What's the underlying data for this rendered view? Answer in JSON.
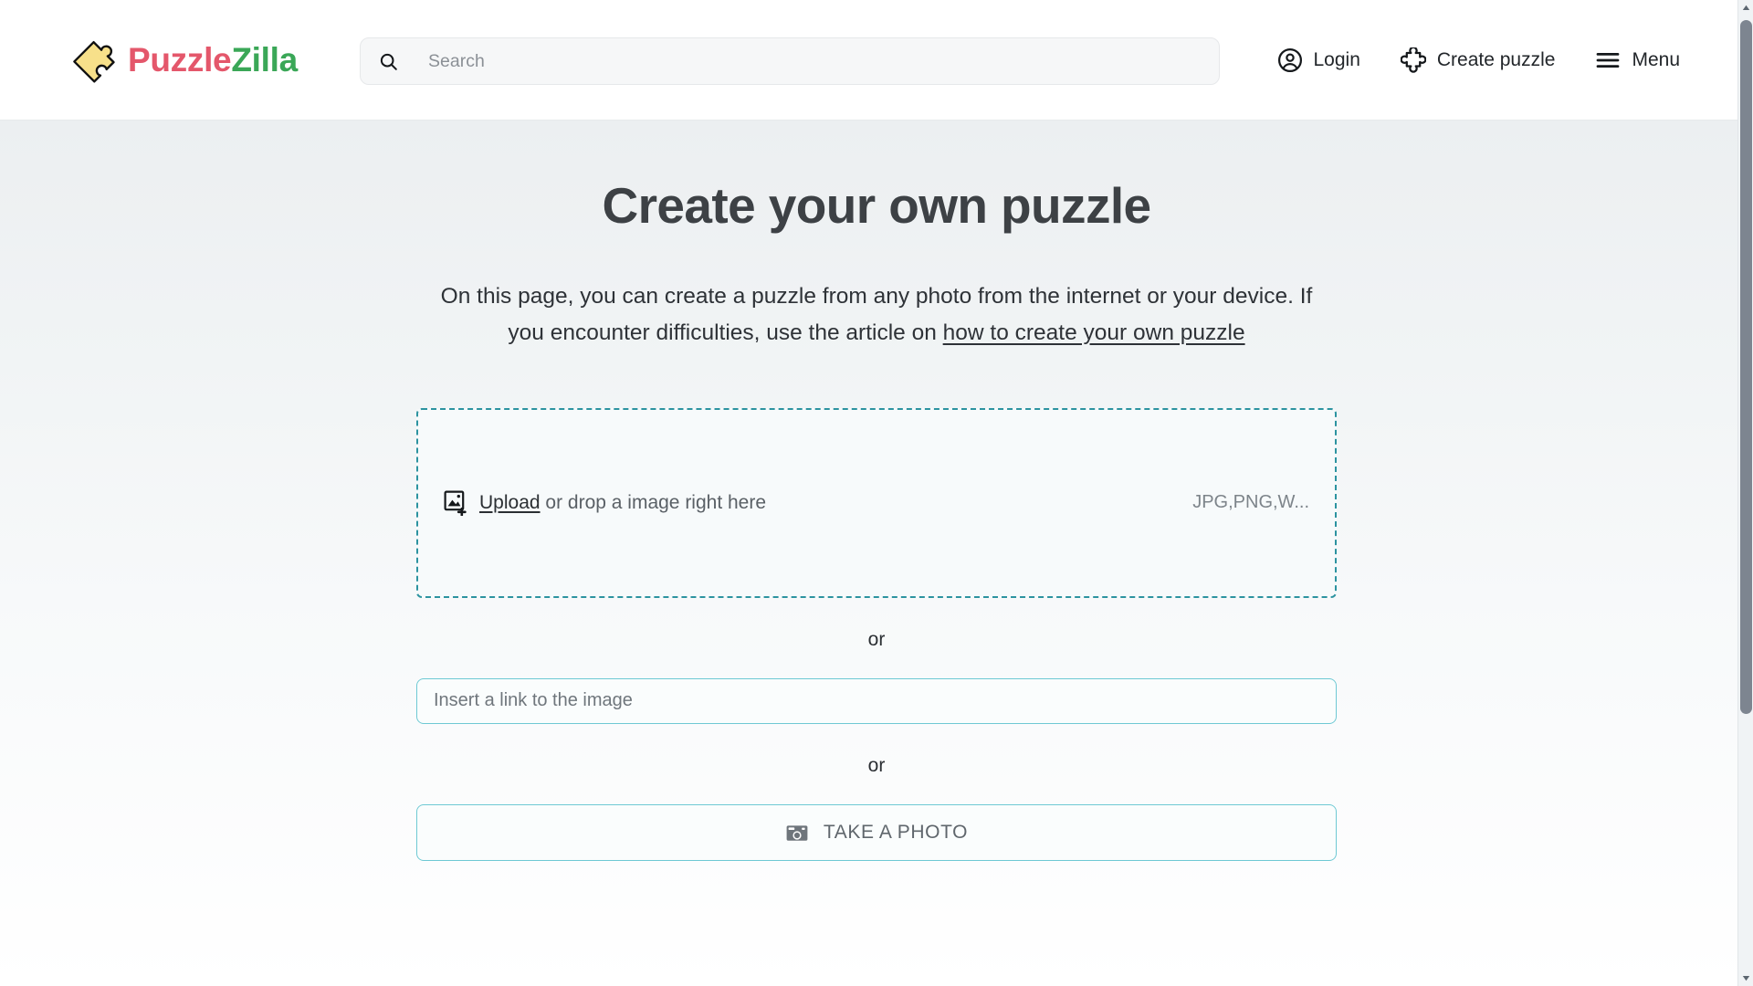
{
  "header": {
    "logo": {
      "icon": "puzzle-piece-logo-icon",
      "text_first": "Puzzle",
      "text_second": "Zilla"
    },
    "search": {
      "placeholder": "Search",
      "value": "",
      "icon": "search-icon"
    },
    "nav": [
      {
        "label": "Login",
        "icon": "user-circle-icon"
      },
      {
        "label": "Create puzzle",
        "icon": "puzzle-piece-icon"
      },
      {
        "label": "Menu",
        "icon": "hamburger-menu-icon"
      }
    ]
  },
  "main": {
    "title": "Create your own puzzle",
    "intro": {
      "before": "On this page, you can create a puzzle from any photo from the internet or your device. If you encounter difficulties, use the article on ",
      "link": "how to create your own puzzle"
    },
    "dropzone": {
      "icon": "add-image-icon",
      "upload_link": "Upload",
      "rest_text": " or drop a image right here",
      "formats": "JPG,PNG,W...",
      "border_color": "#2c93a0"
    },
    "or_label_1": "or",
    "link_field": {
      "placeholder": "Insert a link to the image",
      "value": ""
    },
    "or_label_2": "or",
    "photo_button": {
      "label": "TAKE A PHOTO",
      "icon": "camera-icon"
    }
  },
  "scrollbar": {
    "up_icon": "scroll-up-arrow-icon",
    "down_icon": "scroll-down-arrow-icon"
  },
  "colors": {
    "brand_red": "#e4576b",
    "brand_green": "#3aa757",
    "logo_yellow": "#f7e08a",
    "accent_teal": "#2c93a0",
    "input_border_teal": "#6ec9d4"
  }
}
